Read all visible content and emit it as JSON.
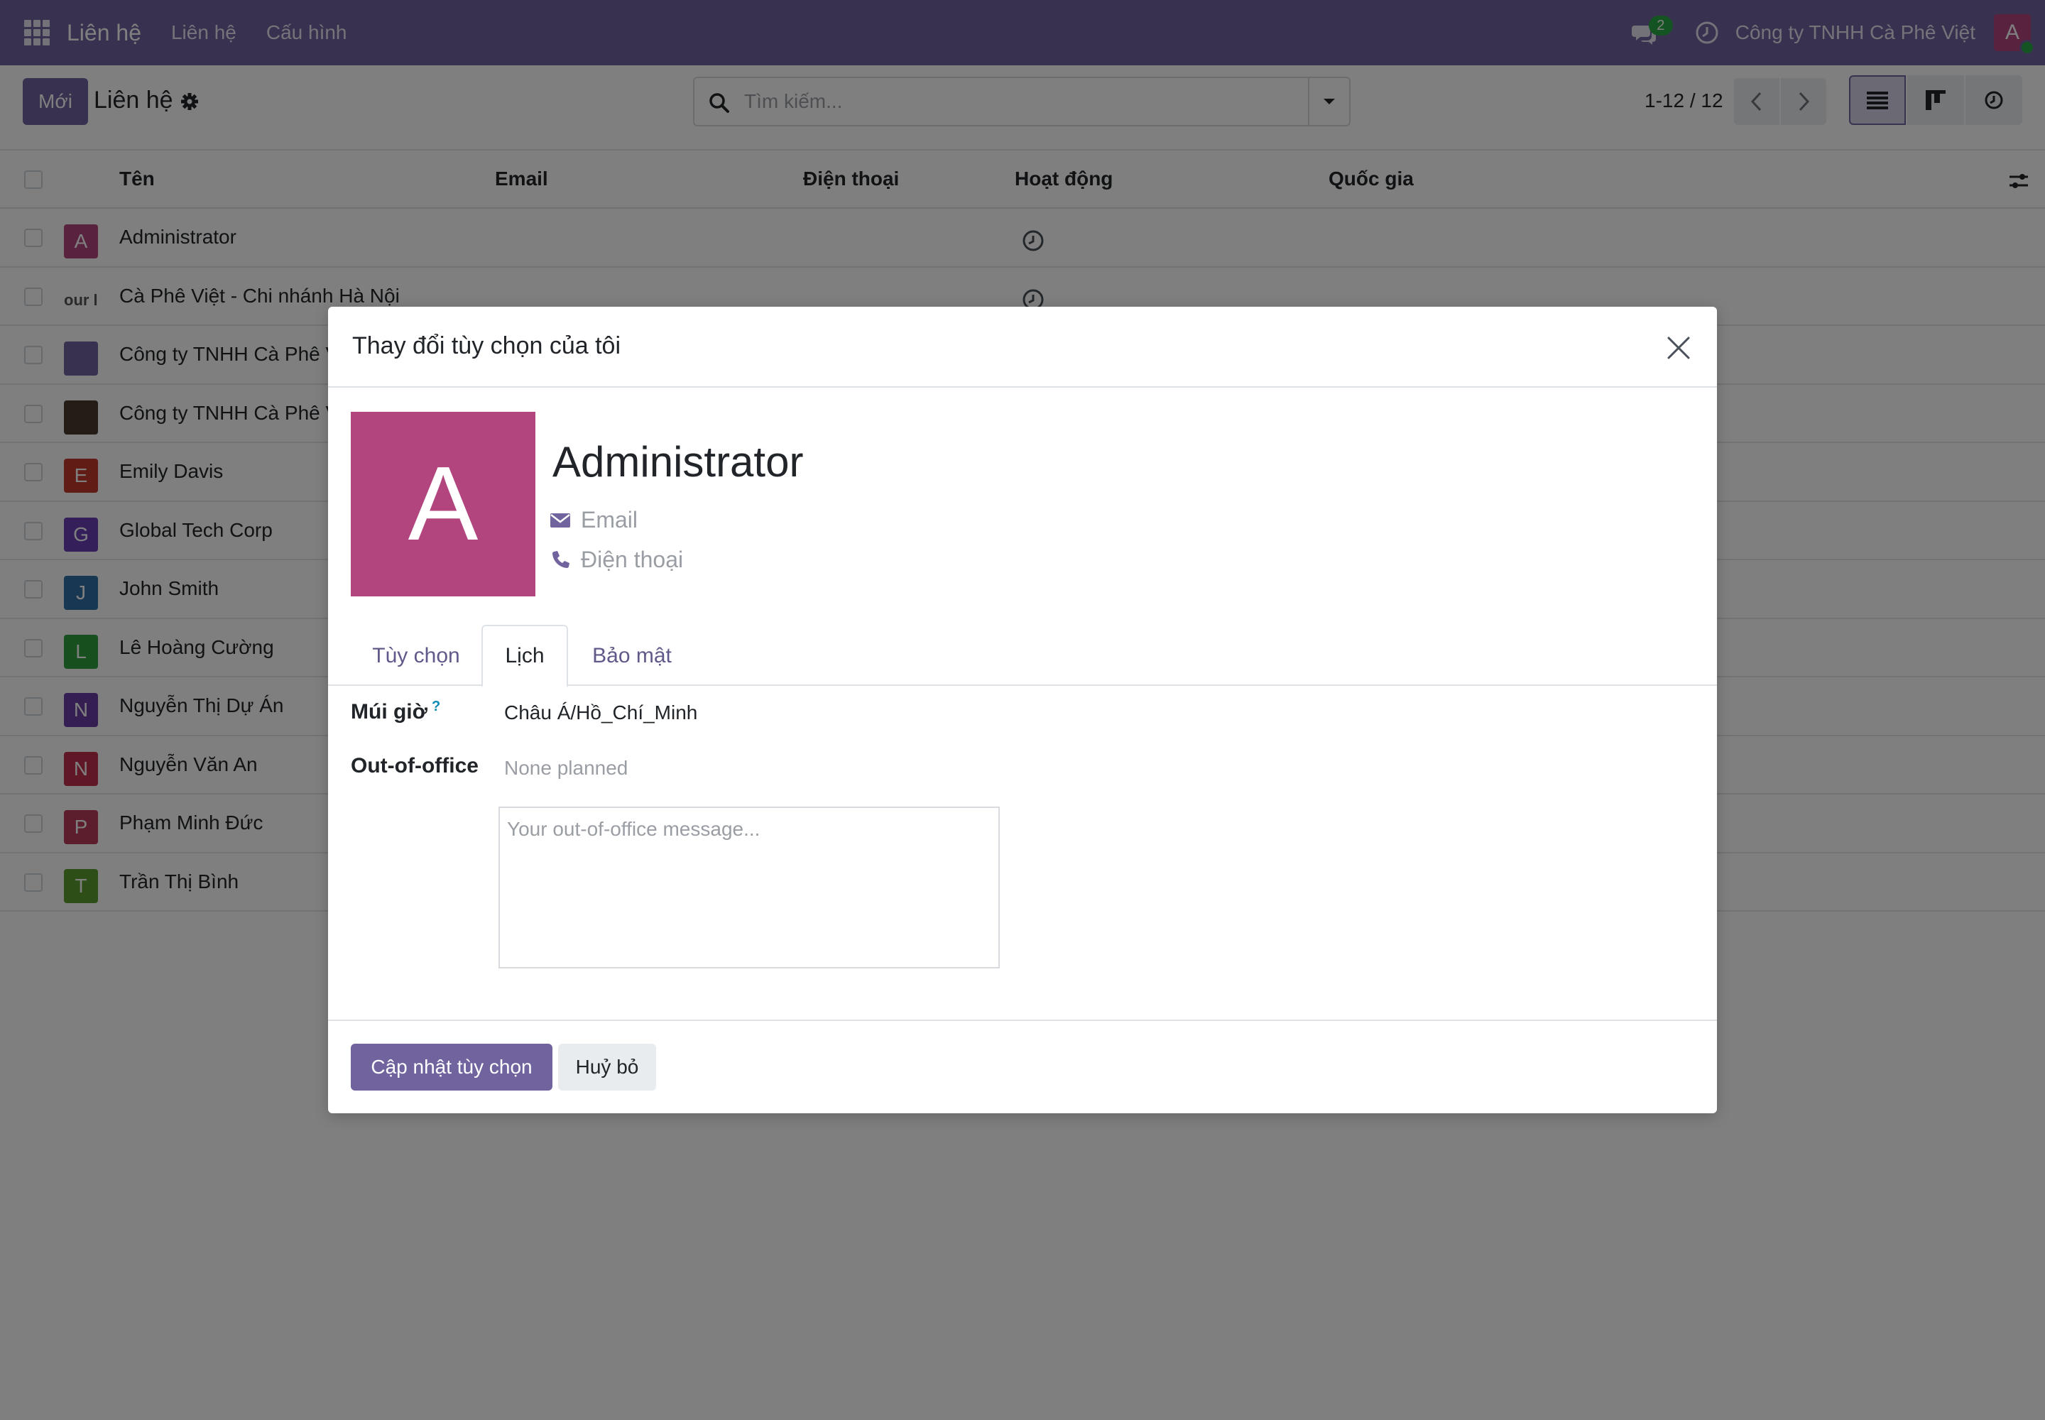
{
  "navbar": {
    "brand": "Liên hệ",
    "menu": [
      "Liên hệ",
      "Cấu hình"
    ],
    "chat_badge": "2",
    "company": "Công ty TNHH Cà Phê Việt",
    "user_initial": "A"
  },
  "control": {
    "new_label": "Mới",
    "title": "Liên hệ",
    "search_placeholder": "Tìm kiếm...",
    "pager": "1-12 / 12"
  },
  "list": {
    "columns": [
      "Tên",
      "Email",
      "Điện thoại",
      "Hoạt động",
      "Quốc gia"
    ],
    "rows": [
      {
        "initial": "A",
        "name": "Administrator",
        "color": "#b3457e"
      },
      {
        "initial": "our l",
        "name": "Cà Phê Việt - Chi nhánh Hà Nội",
        "color": "#ffffff"
      },
      {
        "initial": "",
        "name": "Công ty TNHH Cà Phê Việt",
        "color": "#71639e"
      },
      {
        "initial": "",
        "name": "Công ty TNHH Cà Phê Việt",
        "color": "#4a3a2a"
      },
      {
        "initial": "E",
        "name": "Emily Davis",
        "color": "#c0392b"
      },
      {
        "initial": "G",
        "name": "Global Tech Corp",
        "color": "#6a3fb5"
      },
      {
        "initial": "J",
        "name": "John Smith",
        "color": "#2f6fa5"
      },
      {
        "initial": "L",
        "name": "Lê Hoàng Cường",
        "color": "#2e9e3e"
      },
      {
        "initial": "N",
        "name": "Nguyễn Thị Dự Án",
        "color": "#6a3fa5"
      },
      {
        "initial": "N",
        "name": "Nguyễn Văn An",
        "color": "#c0304d"
      },
      {
        "initial": "P",
        "name": "Phạm Minh Đức",
        "color": "#b83a5a"
      },
      {
        "initial": "T",
        "name": "Trần Thị Bình",
        "color": "#5a9e2e"
      }
    ]
  },
  "modal": {
    "title": "Thay đổi tùy chọn của tôi",
    "avatar_initial": "A",
    "name": "Administrator",
    "email_placeholder": "Email",
    "phone_placeholder": "Điện thoại",
    "tabs": [
      "Tùy chọn",
      "Lịch",
      "Bảo mật"
    ],
    "timezone_label": "Múi giờ",
    "timezone_help": "?",
    "timezone_value": "Châu Á/Hồ_Chí_Minh",
    "ooo_label": "Out-of-office",
    "ooo_value": "None planned",
    "ooo_placeholder": "Your out-of-office message...",
    "save_label": "Cập nhật tùy chọn",
    "cancel_label": "Huỷ bỏ"
  },
  "colors": {
    "brand": "#71639e",
    "avatar": "#b3457e",
    "success": "#28a745"
  }
}
